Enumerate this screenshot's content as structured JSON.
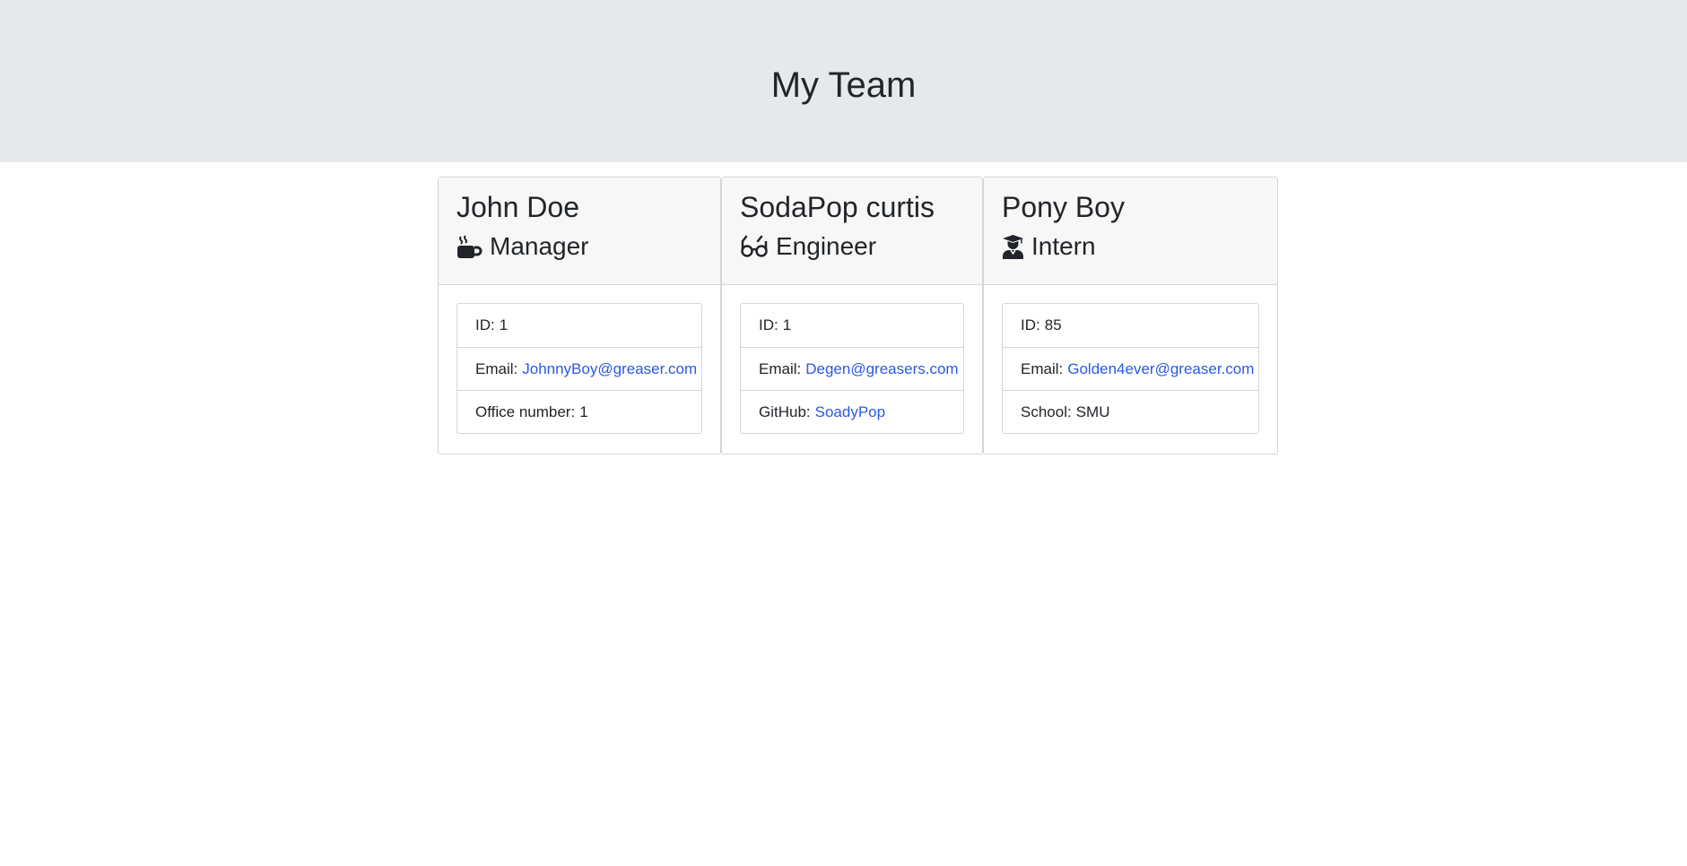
{
  "header": {
    "title": "My Team"
  },
  "team": [
    {
      "name": "John Doe",
      "role": "Manager",
      "icon": "mug-hot-icon",
      "id_label": "ID:",
      "id_value": "1",
      "email_label": "Email:",
      "email_value": "JohnnyBoy@greaser.com",
      "extra_label": "Office number:",
      "extra_value": "1"
    },
    {
      "name": "SodaPop curtis",
      "role": "Engineer",
      "icon": "glasses-icon",
      "id_label": "ID:",
      "id_value": "1",
      "email_label": "Email:",
      "email_value": "Degen@greasers.com",
      "extra_label": "GitHub:",
      "extra_value": "SoadyPop"
    },
    {
      "name": "Pony Boy",
      "role": "Intern",
      "icon": "user-graduate-icon",
      "id_label": "ID:",
      "id_value": "85",
      "email_label": "Email:",
      "email_value": "Golden4ever@greaser.com",
      "extra_label": "School:",
      "extra_value": "SMU"
    }
  ],
  "colors": {
    "header_bg": "#e6e9ec",
    "card_header_bg": "#f7f7f7",
    "link": "#2b59e0",
    "text": "#212529"
  }
}
